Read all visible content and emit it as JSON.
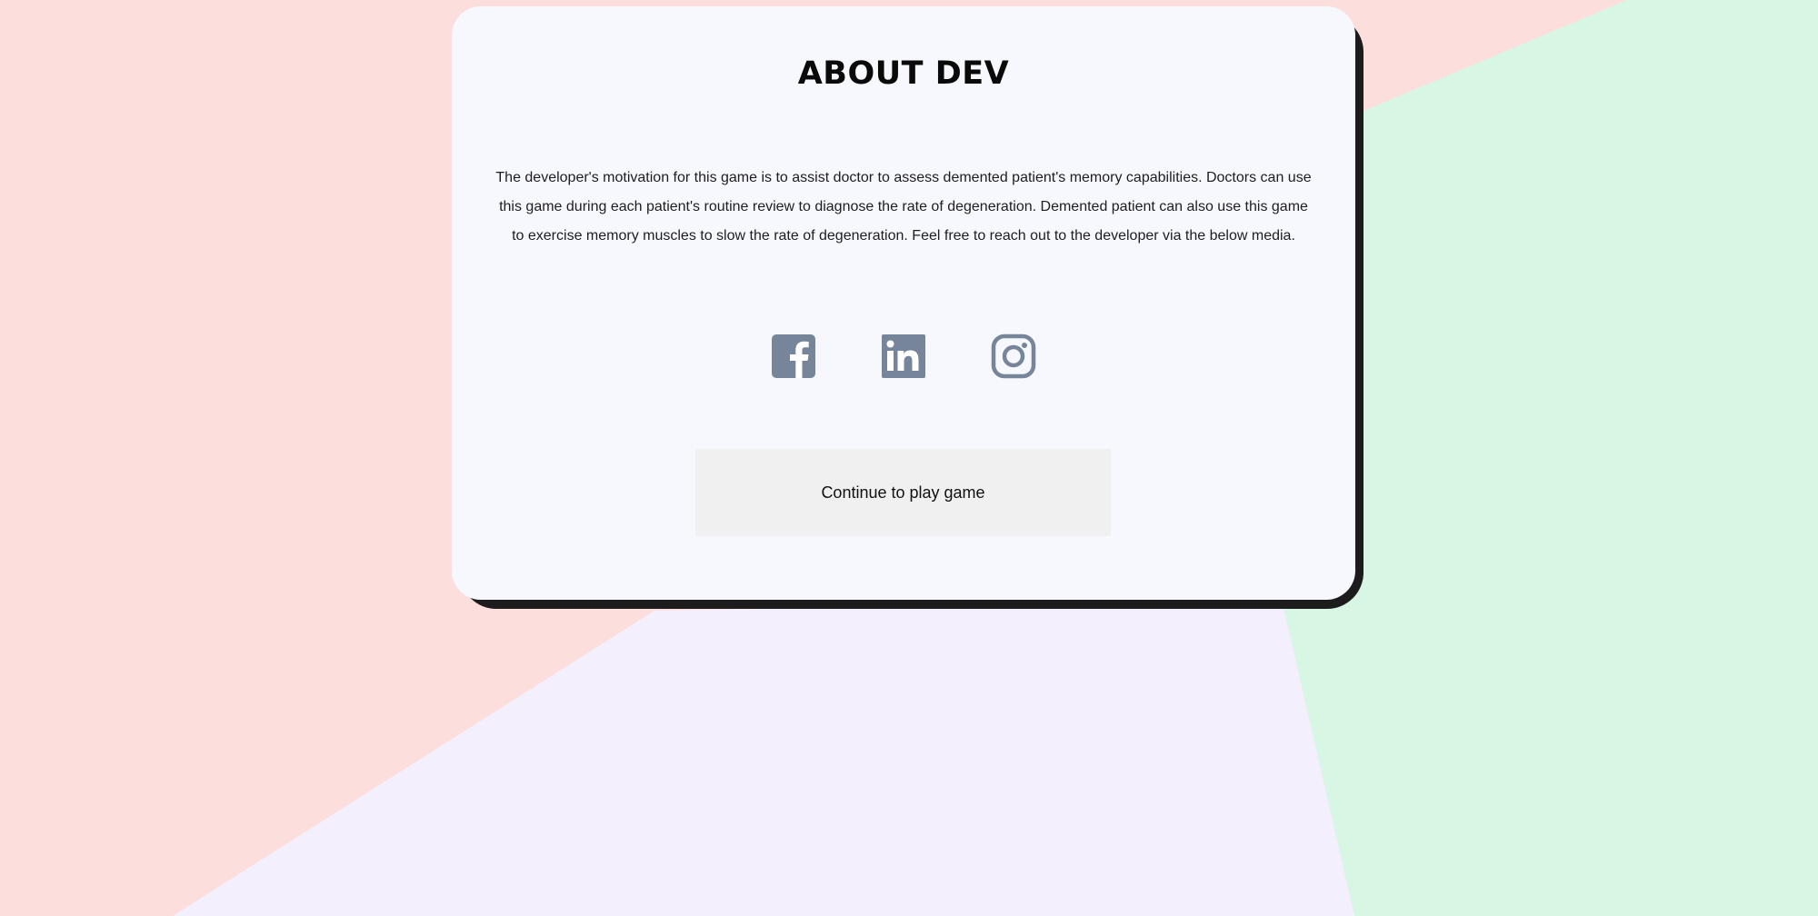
{
  "page": {
    "title": "ABOUT DEV",
    "description": "The developer's motivation for this game is to assist doctor to assess demented patient's memory capabilities. Doctors can use this game during each patient's routine review to diagnose the rate of degeneration. Demented patient can also use this game to exercise memory muscles to slow the rate of degeneration. Feel free to reach out to the developer via the below media."
  },
  "social": [
    {
      "icon": "facebook-icon"
    },
    {
      "icon": "linkedin-icon"
    },
    {
      "icon": "instagram-icon"
    }
  ],
  "actions": {
    "continue_label": "Continue to play game"
  },
  "colors": {
    "background_pink": "#fcdfdd",
    "background_green": "#d8f6e4",
    "background_lavender": "#f4effd",
    "card_background": "#f7f8fe",
    "card_shadow": "#1c1c1c",
    "icon_color": "#76859a",
    "button_background": "#f0f0f0"
  }
}
